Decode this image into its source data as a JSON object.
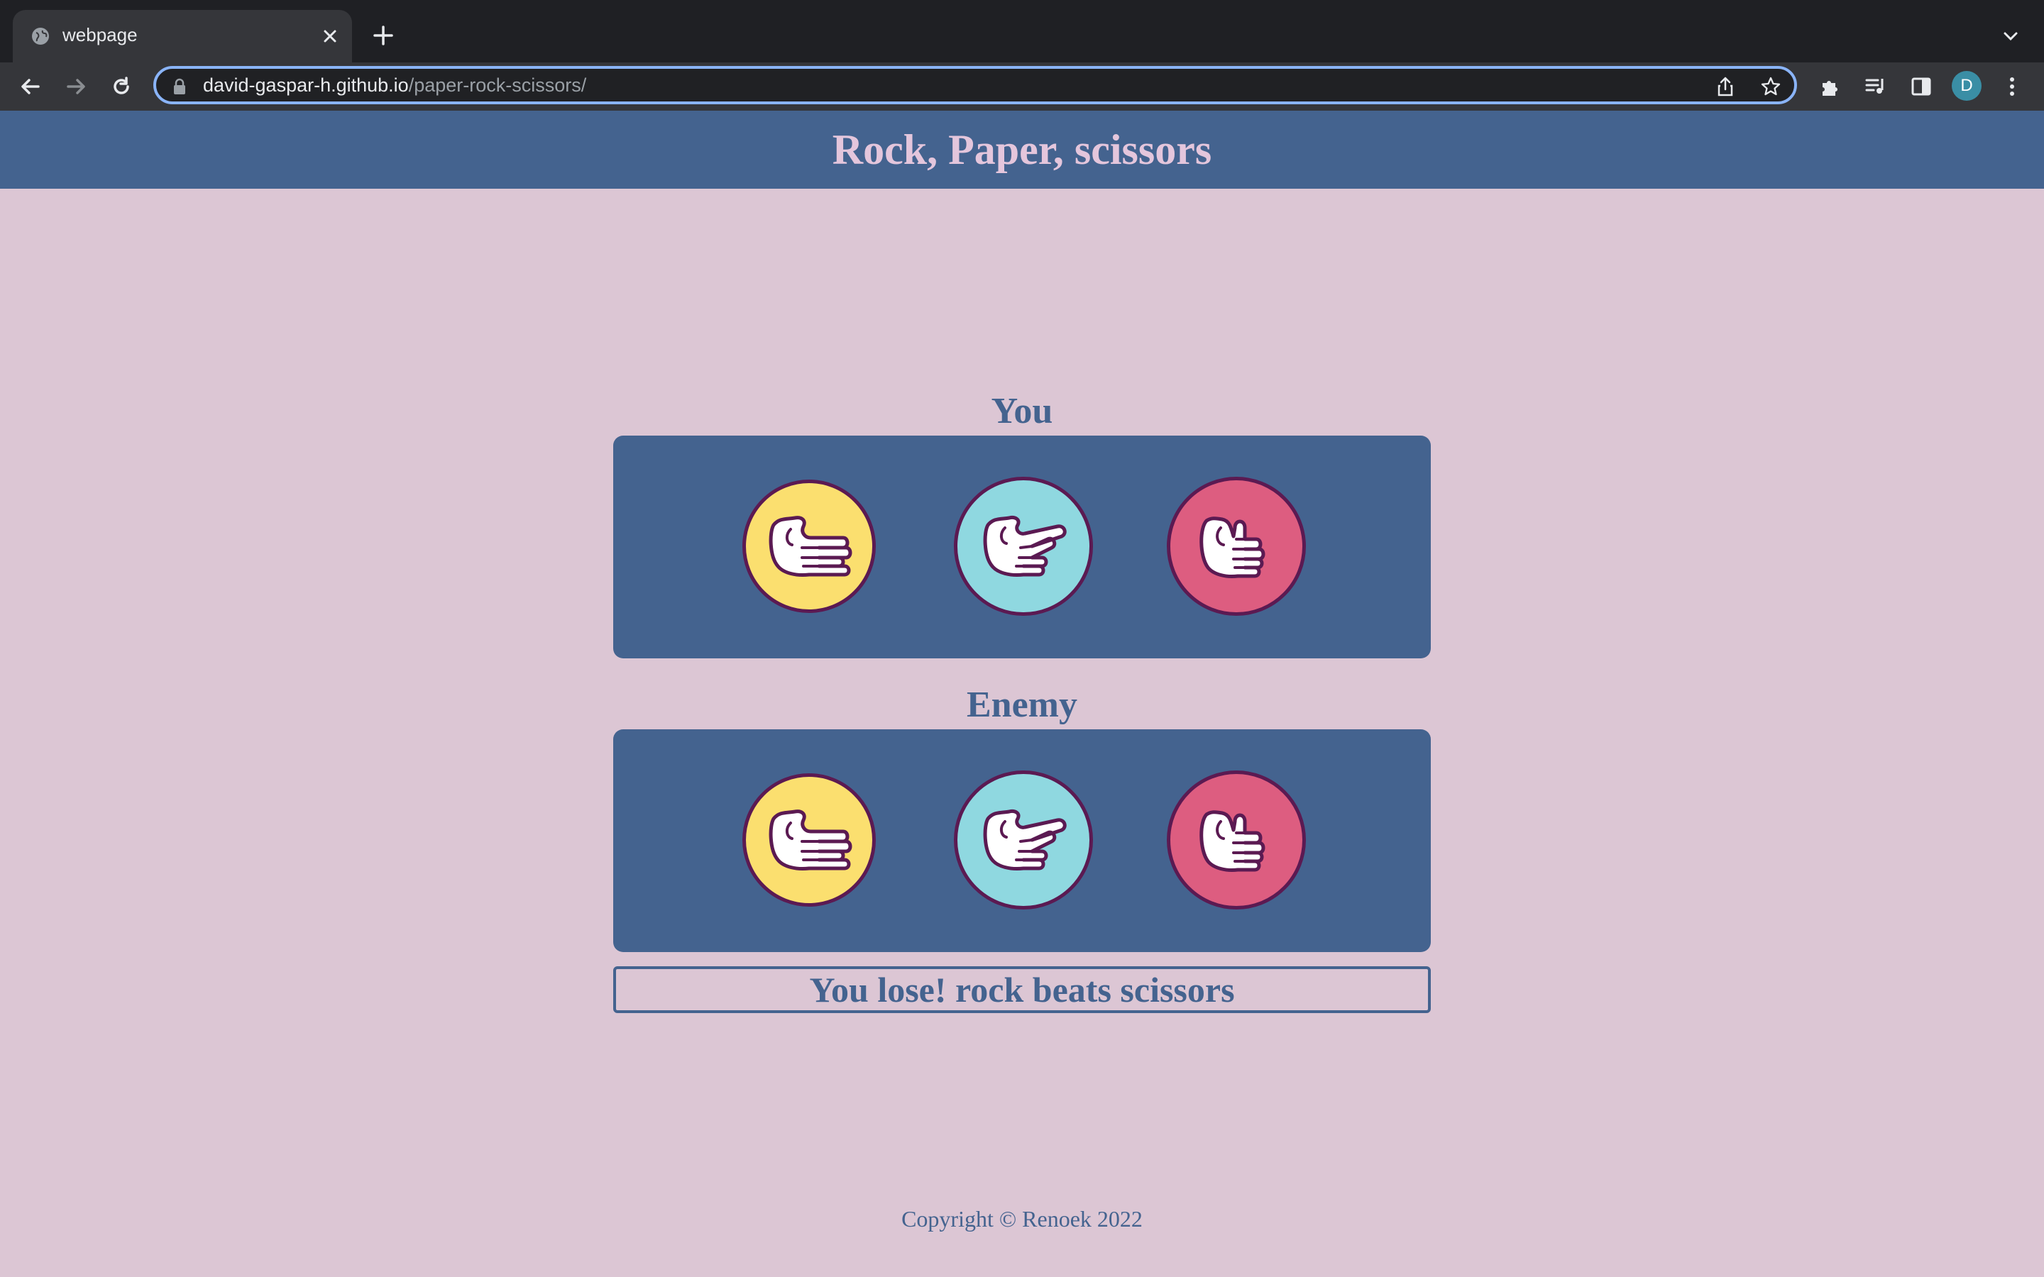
{
  "browser": {
    "tab_title": "webpage",
    "url_domain": "david-gaspar-h.github.io",
    "url_path": "/paper-rock-scissors/",
    "profile_initial": "D"
  },
  "header": {
    "title": "Rock, Paper, scissors"
  },
  "player": {
    "label": "You",
    "choices": [
      "paper",
      "scissors",
      "rock"
    ]
  },
  "enemy": {
    "label": "Enemy",
    "choices": [
      "paper",
      "scissors",
      "rock"
    ]
  },
  "result": {
    "text": "You lose! rock beats scissors"
  },
  "footer": {
    "copyright": "Copyright © Renoek 2022"
  },
  "colors": {
    "page_bg": "#dcc6d4",
    "primary": "#44638f",
    "header_text": "#e4c6dc",
    "paper": "#fbdf6f",
    "scissors": "#8fd8e0",
    "rock": "#dd5d80",
    "outline": "#5b1a52"
  }
}
